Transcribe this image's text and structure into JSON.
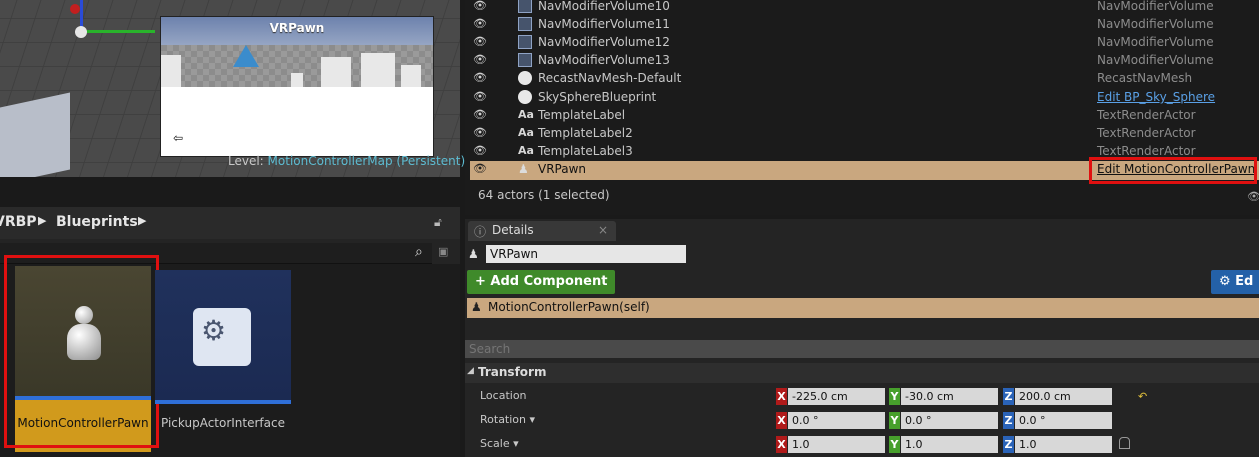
{
  "viewport": {
    "preview_title": "VRPawn",
    "level_prefix": "Level:",
    "level_name": "MotionControllerMap (Persistent)"
  },
  "content_browser": {
    "path": [
      "VRBP",
      "Blueprints"
    ],
    "assets": [
      {
        "label": "MotionControllerPawn",
        "icon": "pawn-icon",
        "selected": true
      },
      {
        "label": "PickupActorInterface",
        "icon": "blueprint-interface-icon",
        "selected": false
      }
    ]
  },
  "outliner": {
    "rows": [
      {
        "name": "NavModifierVolume10",
        "type": "NavModifierVolume",
        "icon": "volume-icon"
      },
      {
        "name": "NavModifierVolume11",
        "type": "NavModifierVolume",
        "icon": "volume-icon"
      },
      {
        "name": "NavModifierVolume12",
        "type": "NavModifierVolume",
        "icon": "volume-icon"
      },
      {
        "name": "NavModifierVolume13",
        "type": "NavModifierVolume",
        "icon": "volume-icon"
      },
      {
        "name": "RecastNavMesh-Default",
        "type": "RecastNavMesh",
        "icon": "sphere-icon"
      },
      {
        "name": "SkySphereBlueprint",
        "type": "Edit BP_Sky_Sphere",
        "icon": "sphere-icon",
        "link": true
      },
      {
        "name": "TemplateLabel",
        "type": "TextRenderActor",
        "icon": "text-render-icon"
      },
      {
        "name": "TemplateLabel2",
        "type": "TextRenderActor",
        "icon": "text-render-icon"
      },
      {
        "name": "TemplateLabel3",
        "type": "TextRenderActor",
        "icon": "text-render-icon"
      },
      {
        "name": "VRPawn",
        "type": "Edit MotionControllerPawn",
        "icon": "pawn-icon",
        "selected": true
      }
    ],
    "actor_count": "64 actors (1 selected)"
  },
  "details": {
    "tab_label": "Details",
    "actor_name": "VRPawn",
    "add_component_label": "+ Add Component ▾",
    "edit_blueprint_label": "⚙ Ed",
    "component_self": "MotionControllerPawn(self)",
    "search_placeholder": "Search",
    "section_title": "Transform",
    "properties": [
      {
        "label": "Location",
        "x": "-225.0 cm",
        "y": "-30.0 cm",
        "z": "200.0 cm"
      },
      {
        "label": "Rotation ▾",
        "x": "0.0 °",
        "y": "0.0 °",
        "z": "0.0 °"
      },
      {
        "label": "Scale ▾",
        "x": "1.0",
        "y": "1.0",
        "z": "1.0"
      }
    ]
  }
}
